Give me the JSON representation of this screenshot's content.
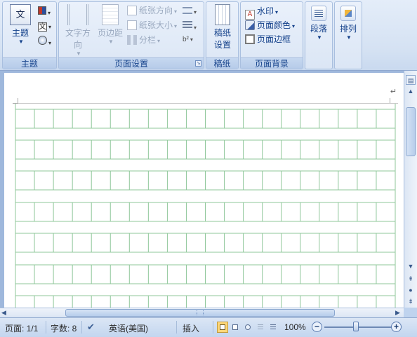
{
  "ribbon": {
    "groups": {
      "theme": {
        "label": "主题",
        "theme_button": "主题"
      },
      "page_setup": {
        "label": "页面设置",
        "text_direction": "文字方向",
        "margins": "页边距",
        "orientation": "纸张方向",
        "size": "纸张大小",
        "columns": "分栏"
      },
      "manuscript": {
        "label": "稿纸",
        "manuscript_settings_line1": "稿纸",
        "manuscript_settings_line2": "设置"
      },
      "page_background": {
        "label": "页面背景",
        "watermark": "水印",
        "page_color": "页面颜色",
        "page_borders": "页面边框"
      },
      "paragraph": {
        "label": "段落"
      },
      "arrange": {
        "label": "排列"
      }
    }
  },
  "document": {
    "paragraph_mark": "↵",
    "grid_color": "#8fc79a"
  },
  "status_bar": {
    "page": "页面: 1/1",
    "word_count": "字数: 8",
    "language": "英语(美国)",
    "insert_mode": "插入",
    "zoom": "100%",
    "zoom_minus": "−",
    "zoom_plus": "+"
  },
  "icons": {
    "theme": "theme-icon",
    "colors": "theme-colors-icon",
    "fonts": "theme-fonts-icon",
    "effects": "theme-effects-icon"
  }
}
